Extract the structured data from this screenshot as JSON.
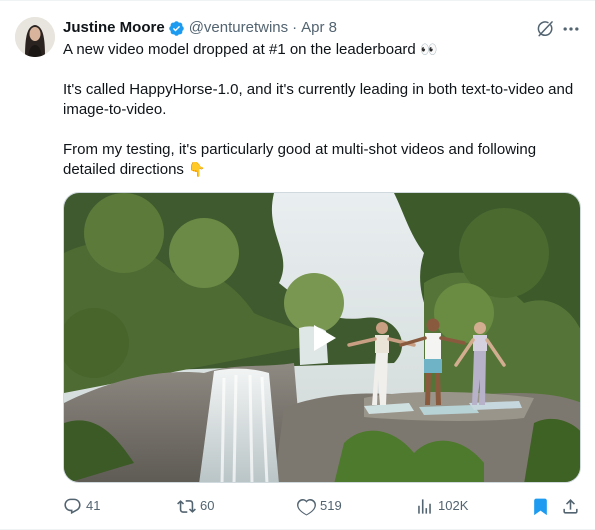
{
  "author": {
    "name": "Justine Moore",
    "handle": "@venturetwins",
    "date": "Apr 8",
    "verified": true
  },
  "tweet": {
    "line1": "A new video model dropped at #1 on the leaderboard",
    "line1_emoji": "👀",
    "para2": "It's called HappyHorse-1.0, and it's currently leading in both text-to-video and image-to-video.",
    "para3": "From my testing, it's particularly good at multi-shot videos and following detailed directions",
    "para3_emoji": "👇"
  },
  "media": {
    "type": "video",
    "icon": "play-icon"
  },
  "actions": {
    "replies": "41",
    "reposts": "60",
    "likes": "519",
    "views": "102K"
  },
  "colors": {
    "verified_blue": "#1d9bf0",
    "secondary_text": "#536471",
    "bookmark_active": "#1d9bf0"
  }
}
